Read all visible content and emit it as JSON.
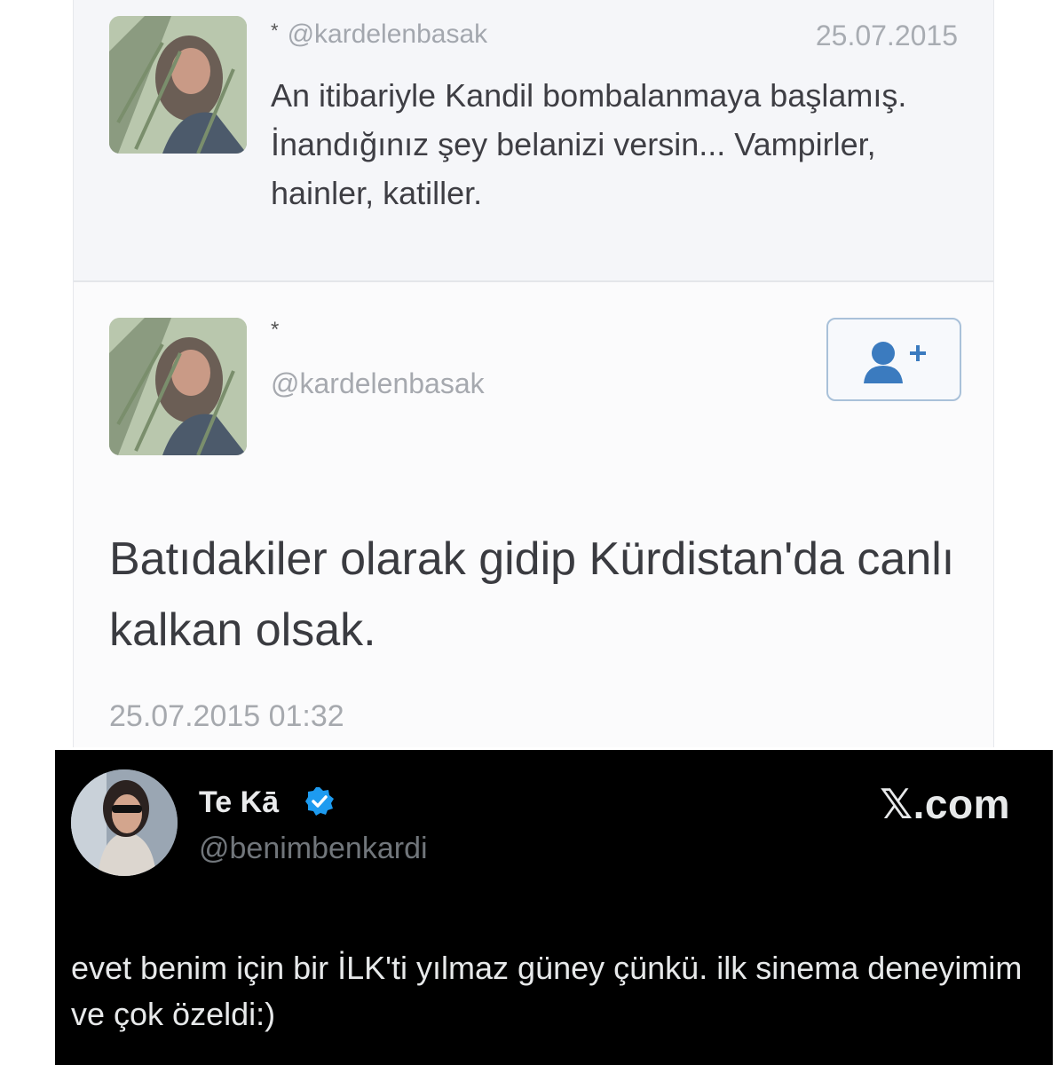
{
  "old_tweet": {
    "star": "*",
    "handle": "@kardelenbasak",
    "date": "25.07.2015",
    "text": "An itibariyle Kandil bombalanmaya başlamış. İnandığınız şey belanizi versin... Vampirler, hainler, katiller."
  },
  "profile_tweet": {
    "star": "*",
    "handle": "@kardelenbasak",
    "text": "Batıdakiler olarak gidip Kürdistan'da canlı kalkan olsak.",
    "timestamp": "25.07.2015 01:32",
    "follow_icon": "follow-user-plus-icon"
  },
  "x_post": {
    "display_name": "Te Kā",
    "handle": "@benimbenkardi",
    "brand": "𝕏.com",
    "verified_icon": "verified-badge-icon",
    "text": "evet benim için bir İLK'ti yılmaz güney çünkü. ilk sinema deneyimim ve çok özeldi:)"
  },
  "colors": {
    "x_background": "#000000",
    "verified_blue": "#1d9bf0",
    "follow_border": "#a9c1d9",
    "follow_icon": "#3b7bbf"
  }
}
